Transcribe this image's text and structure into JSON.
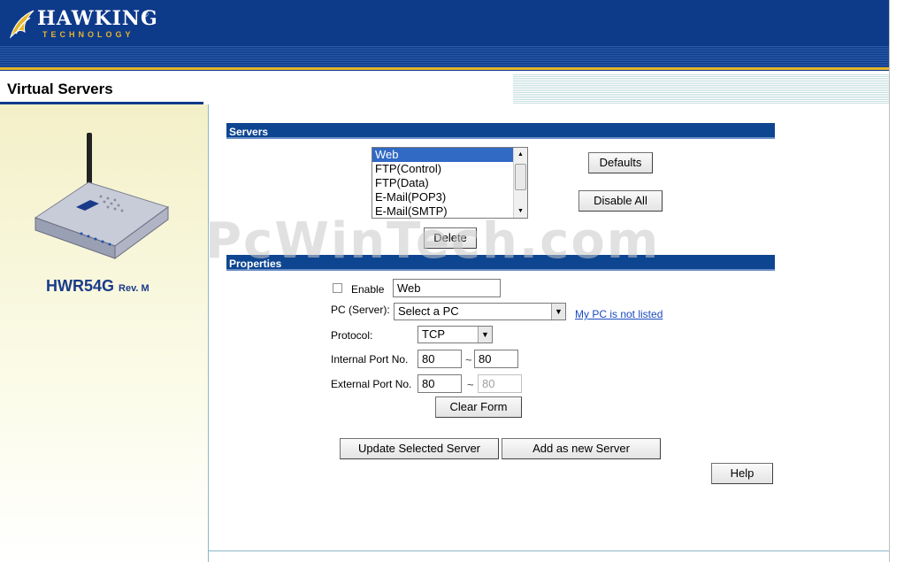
{
  "brand": {
    "name": "HAWKING",
    "sub": "TECHNOLOGY",
    "reg": "®"
  },
  "page": {
    "title": "Virtual Servers"
  },
  "device": {
    "model": "HWR54G",
    "rev": "Rev. M"
  },
  "servers": {
    "header": "Servers",
    "items": [
      "Web",
      "FTP(Control)",
      "FTP(Data)",
      "E-Mail(POP3)",
      "E-Mail(SMTP)"
    ],
    "selected_index": 0,
    "defaults_label": "Defaults",
    "disable_all_label": "Disable All",
    "delete_label": "Delete"
  },
  "properties": {
    "header": "Properties",
    "enable_label": "Enable",
    "enable_checked": false,
    "name_value": "Web",
    "pc_label": "PC (Server):",
    "pc_selected": "Select a PC",
    "pc_not_listed_link": "My PC is not listed",
    "protocol_label": "Protocol:",
    "protocol_selected": "TCP",
    "internal_port_label": "Internal Port No.",
    "internal_port_start": "80",
    "internal_port_end": "80",
    "external_port_label": "External Port No.",
    "external_port_start": "80",
    "external_port_end": "80",
    "range_separator": "~",
    "clear_form_label": "Clear Form",
    "update_label": "Update Selected Server",
    "add_label": "Add as new Server",
    "help_label": "Help"
  },
  "watermark": "PcWinTech.com",
  "colors": {
    "header_blue": "#0e3a8a",
    "accent_gold": "#e6b52a",
    "selection": "#316ac5",
    "link": "#1a4ac0"
  },
  "icons": {
    "logo": "hawk-logo-icon",
    "device": "router-icon",
    "scroll_up": "arrow-up-icon",
    "scroll_down": "arrow-down-icon",
    "dropdown": "chevron-down-icon"
  }
}
